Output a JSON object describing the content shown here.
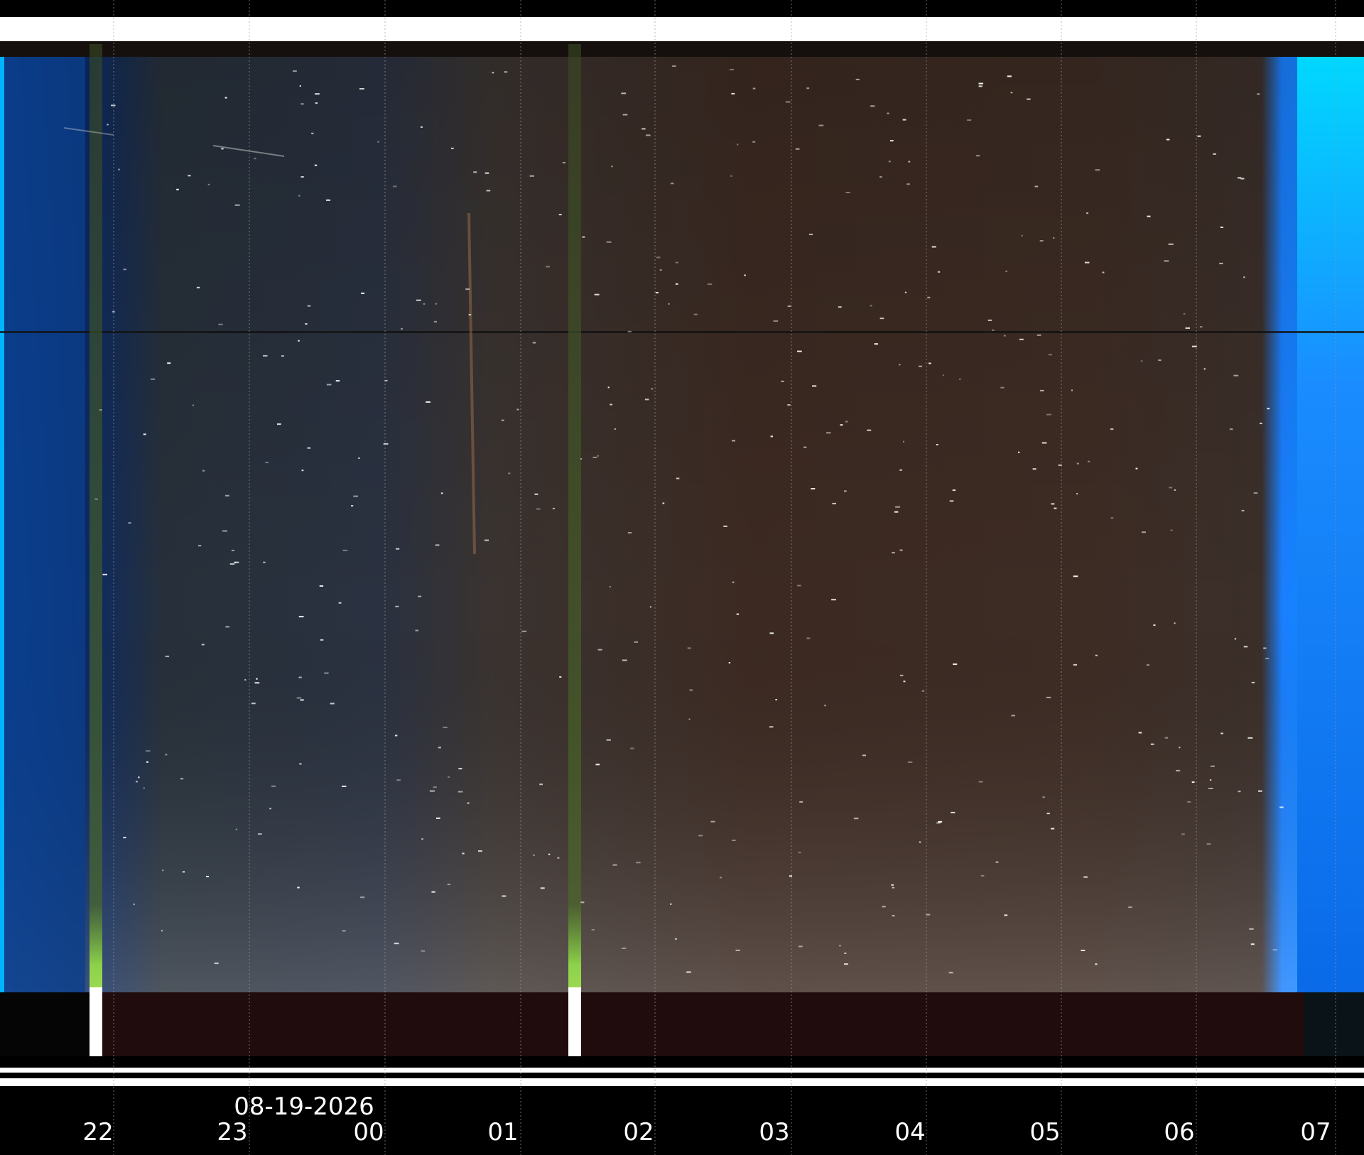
{
  "date_label": "08-19-2026",
  "hour_labels": [
    "22",
    "23",
    "00",
    "01",
    "02",
    "03",
    "04",
    "05",
    "06",
    "07"
  ],
  "colors": {
    "background": "#000000",
    "label_text": "#ffffff",
    "dusk_dawn_blue": "#1a8cff",
    "dawn_cyan": "#00d8ff",
    "night_blue_gray": "#2c3440",
    "night_brown": "#3a2a22",
    "ground_dark": "#200c0c",
    "aurora_green": "#8cd24a",
    "gridline": "#9a9a9a"
  }
}
